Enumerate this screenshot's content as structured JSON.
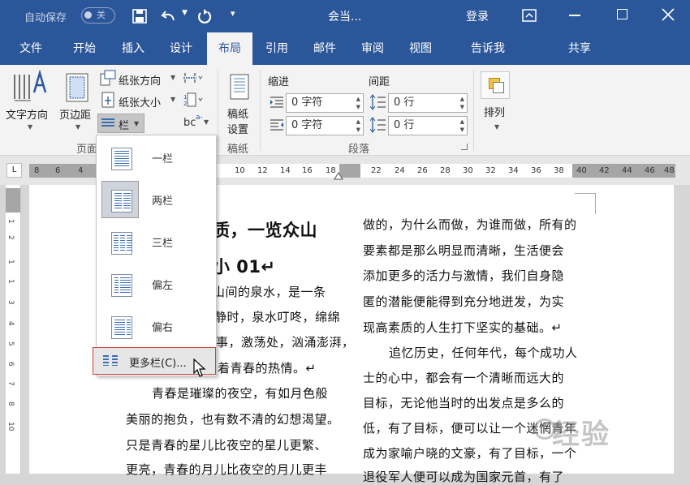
{
  "titlebar": {
    "autosave_label": "自动保存",
    "autosave_state": "关",
    "doc_title": "会当...",
    "login": "登录"
  },
  "tabs": [
    "文件",
    "开始",
    "插入",
    "设计",
    "布局",
    "引用",
    "邮件",
    "审阅",
    "视图",
    "告诉我",
    "共享"
  ],
  "ribbon": {
    "text_direction": "文字方向",
    "margins": "页边距",
    "paper_dir": "纸张方向",
    "paper_size": "纸张大小",
    "columns": "栏",
    "group_page": "页面",
    "manuscript": "稿纸",
    "manuscript_setup": "稿纸",
    "manuscript_setup2": "设置",
    "group_manuscript": "稿纸",
    "indent_label": "缩进",
    "spacing_label": "间距",
    "indent_left": "0 字符",
    "indent_right": "0 字符",
    "spacing_before": "0 行",
    "spacing_after": "0 行",
    "group_paragraph": "段落",
    "arrange": "排列"
  },
  "ruler": {
    "left_nums": [
      "8",
      "6",
      "4"
    ],
    "mid_nums": [
      "10",
      "12",
      "14",
      "16",
      "18",
      "22",
      "24",
      "26",
      "28",
      "30",
      "32",
      "34",
      "36",
      "38"
    ],
    "right_nums": [
      "40",
      "42",
      "44",
      "46",
      "48"
    ],
    "vnums": [
      "1",
      "2",
      "1",
      "1",
      "2",
      "3",
      "4",
      "5",
      "6",
      "7",
      "8",
      "9",
      "10",
      "11",
      "12"
    ]
  },
  "dropdown": {
    "items": [
      "一栏",
      "两栏",
      "三栏",
      "偏左",
      "偏右"
    ],
    "more": "更多栏(C)..."
  },
  "doc": {
    "left": [
      "质，一览众山",
      "小 01↵",
      "山间的泉水，是一条",
      "静时，泉水叮咚，绵绵",
      "事，激荡处，汹涌澎湃，",
      "着青春的热情。↵",
      "青春是璀璨的夜空，有如月色般",
      "美丽的抱负，也有数不清的幻想渴望。",
      "只是青春的星儿比夜空的星儿更繁、",
      "更亮，青春的月儿比夜空的月儿更丰"
    ],
    "right": [
      "做的，为什么而做，为谁而做，所有的",
      "要素都是那么明显而清晰，生活便会",
      "添加更多的活力与激情，我们自身隐",
      "匿的潜能便能得到充分地迸发，为实",
      "现高素质的人生打下坚实的基础。↵",
      "追忆历史，任何年代，每个成功人",
      "士的心中，都会有一个清晰而远大的",
      "目标，无论他当时的出发点是多么的",
      "低，有了目标，便可以让一个迷惘青年",
      "成为家喻户晓的文豪，有了目标，一个",
      "退役军人便可以成为国家元首，有了"
    ]
  },
  "watermark": "经验"
}
